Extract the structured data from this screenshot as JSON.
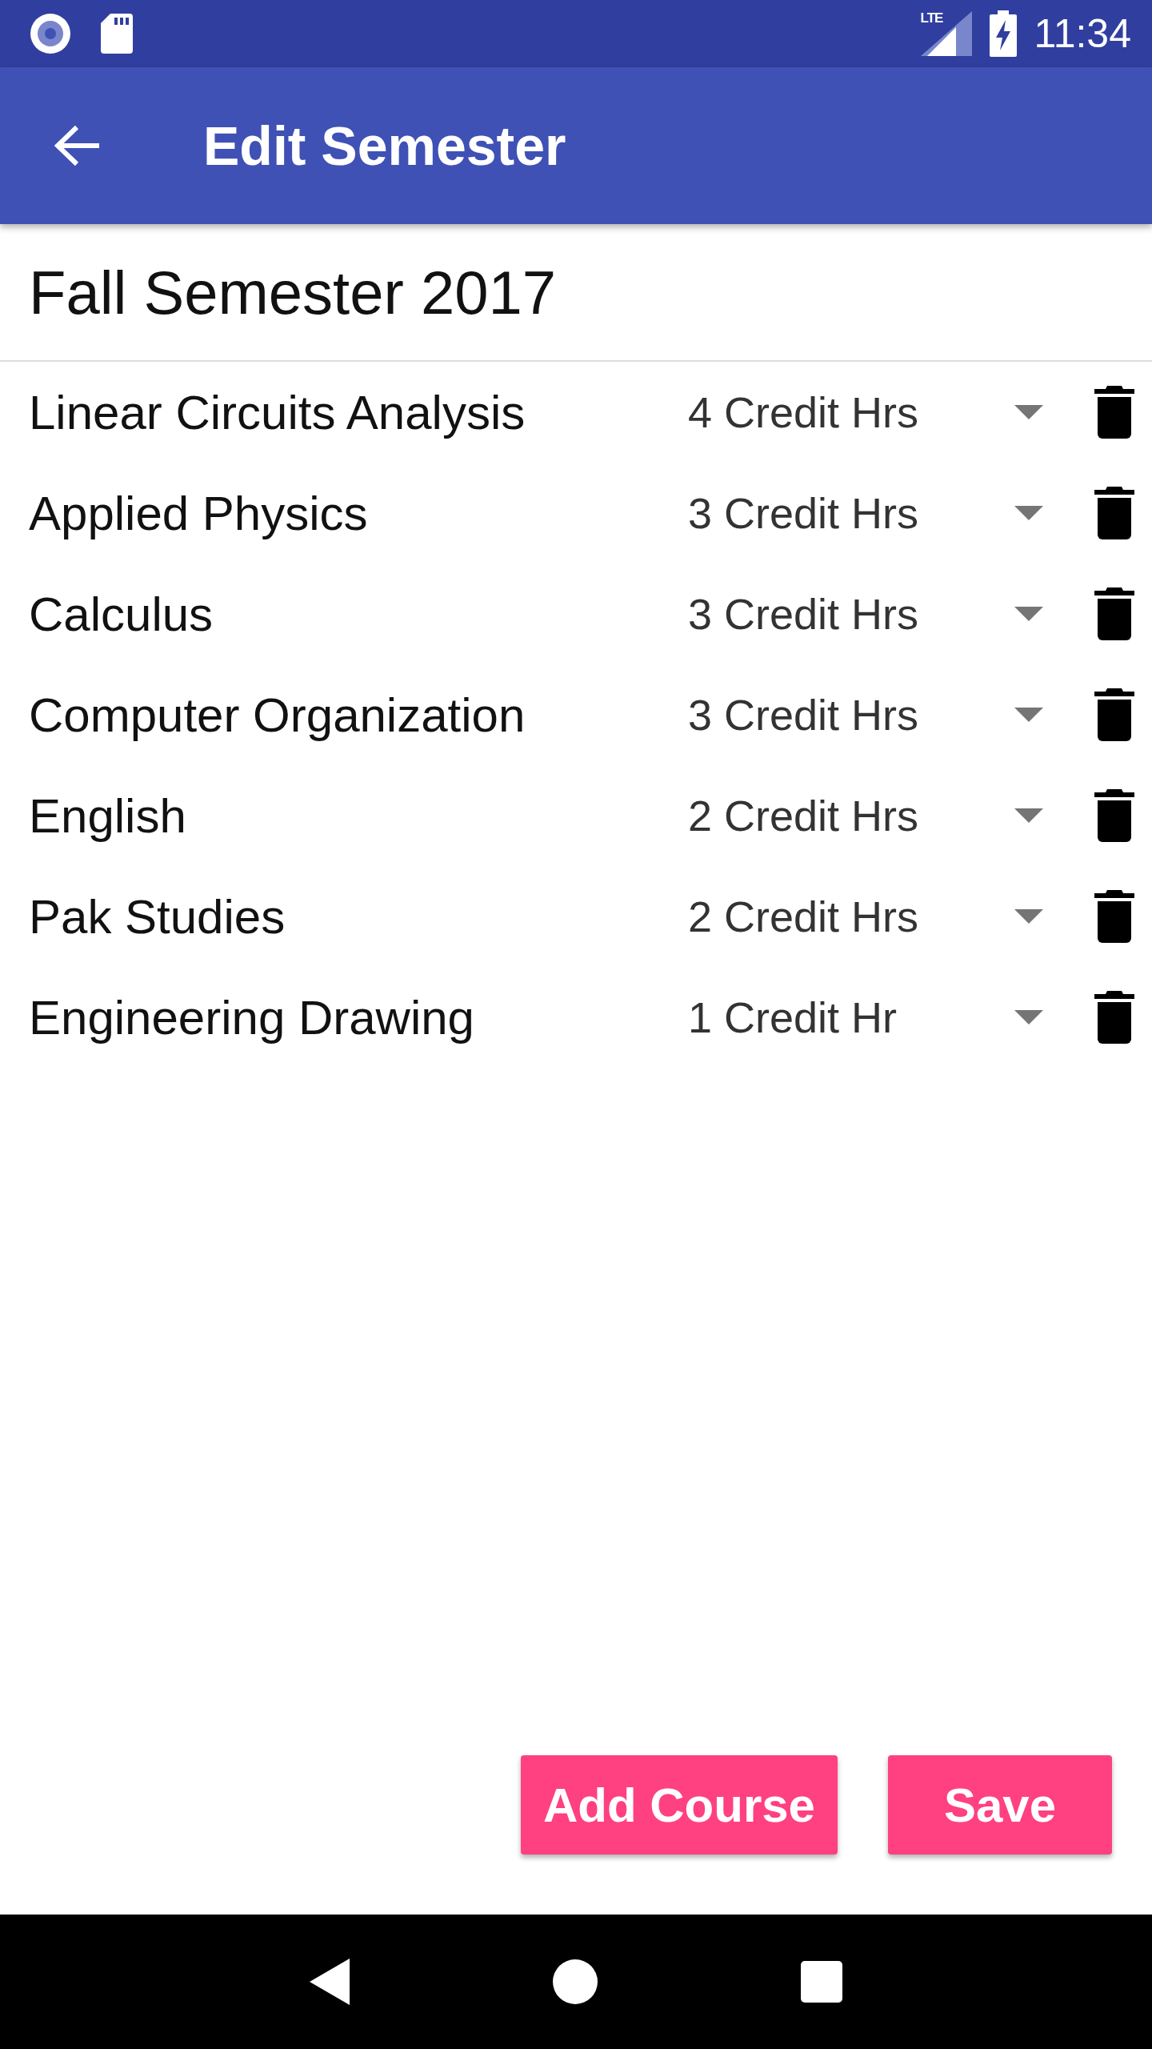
{
  "status_bar": {
    "network": "LTE",
    "time": "11:34"
  },
  "app_bar": {
    "title": "Edit Semester"
  },
  "semester_name": "Fall Semester 2017",
  "courses": [
    {
      "name": "Linear Circuits Analysis",
      "credits": "4 Credit Hrs"
    },
    {
      "name": "Applied Physics",
      "credits": "3 Credit Hrs"
    },
    {
      "name": "Calculus",
      "credits": "3 Credit Hrs"
    },
    {
      "name": "Computer Organization",
      "credits": "3 Credit Hrs"
    },
    {
      "name": "English",
      "credits": "2 Credit Hrs"
    },
    {
      "name": "Pak Studies",
      "credits": "2 Credit Hrs"
    },
    {
      "name": "Engineering Drawing",
      "credits": "1 Credit Hr"
    }
  ],
  "buttons": [
    "Add Course",
    "Save"
  ]
}
